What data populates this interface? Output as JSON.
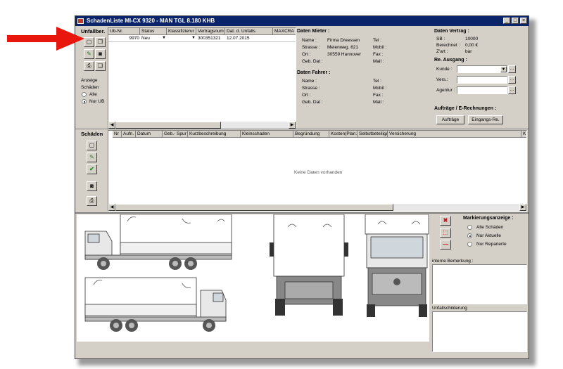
{
  "window": {
    "title": "SchadenListe MI-CX 9320 - MAN TGL 8.180 KHB"
  },
  "accidents": {
    "section_label": "Unfallber.",
    "columns": [
      "Ub-Nr.",
      "Status",
      "Klassifizierur",
      "Vertragsnum",
      "Dat. d. Unfalls",
      "MAXCRA"
    ],
    "row": {
      "ub_nr": "9970",
      "status": "Neu",
      "vertrag": "300351321",
      "datum": "12.07.2015"
    },
    "anzeige_label": "Anzeige",
    "schaeden_label": "Schäden",
    "radio_alle": "Alle",
    "radio_nur_ub": "Nur UB"
  },
  "mieter": {
    "title": "Daten Mieter :",
    "name_label": "Name :",
    "name": "Firma Dreessen",
    "strasse_label": "Strasse :",
    "strasse": "Meienweg. 621",
    "ort_label": "Ort :",
    "ort": "30559 Hannover",
    "geb_label": "Geb. Dat :",
    "tel_label": "Tel :",
    "mobil_label": "Mobil :",
    "fax_label": "Fax :",
    "mail_label": "Mail :"
  },
  "fahrer": {
    "title": "Daten Fahrer :",
    "name_label": "Name :",
    "strasse_label": "Strasse :",
    "ort_label": "Ort :",
    "geb_label": "Geb. Dat :",
    "tel_label": "Tel :",
    "mobil_label": "Mobil :",
    "fax_label": "Fax :",
    "mail_label": "Mail :"
  },
  "vertrag": {
    "title": "Daten Vertrag :",
    "sb_label": "SB :",
    "sb": "10000",
    "berechnet_label": "Berechnet :",
    "berechnet": "0,00 €",
    "zart_label": "Z'art :",
    "zart": "bar"
  },
  "ausgang": {
    "title": "Re. Ausgang :",
    "kunde_label": "Kunde :",
    "vers_label": "Vers.:",
    "agentur_label": "Agentur :"
  },
  "auftraege": {
    "title": "Aufträge / E-Rechnungen :",
    "btn_auftraege": "Aufträge",
    "btn_eingangs": "Eingangs-Re."
  },
  "schaeden": {
    "section_label": "Schäden",
    "columns": [
      "Nr",
      "Aufn.",
      "Datum",
      "Geb.- Spur",
      "Kurzbeschreibung",
      "Kleinschaden",
      "Begründung",
      "Kosten(Plan.",
      "Selbstbeteiligu",
      "Versicherung",
      "K"
    ],
    "empty_text": "Keine Daten vorhanden"
  },
  "markierung": {
    "title": "Markierungsanzeige :",
    "opt_alle": "Alle Schäden",
    "opt_aktuelle": "Nur Aktuelle",
    "opt_reparierte": "Nur Reparierte"
  },
  "bemerkung_label": "interne Bemerkung :",
  "unfallschilderung_label": "Unfallschilderung",
  "accent_colors": {
    "title_bar": "#0a246a",
    "arrow": "#e8160c"
  }
}
